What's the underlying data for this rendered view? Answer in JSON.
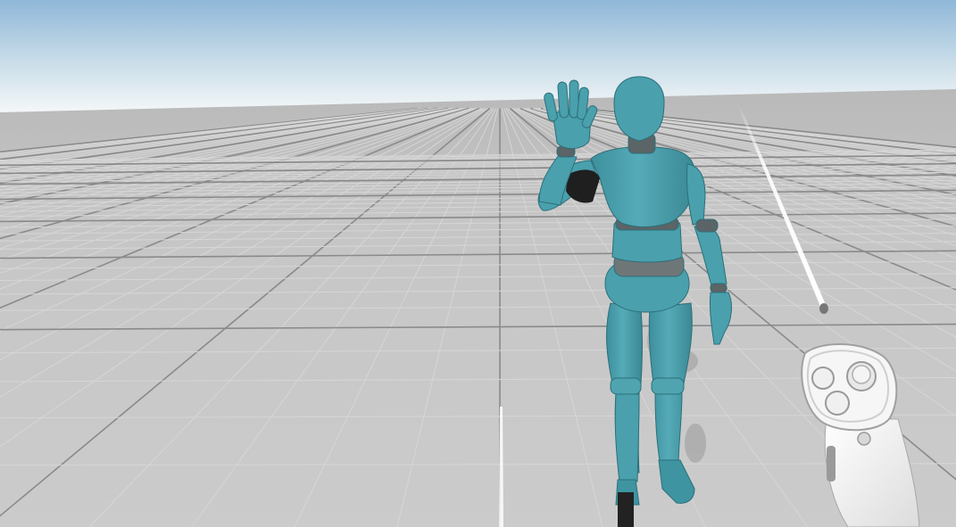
{
  "scene": {
    "type": "vr-3d-viewport",
    "environment": "infinite-grid-floor",
    "sky_top": "#9cc0dd",
    "sky_horizon": "#f2f6f8",
    "floor_color": "#c4c4c4",
    "grid_minor_color": "#d6d6d6",
    "grid_major_color": "#8a8a8a"
  },
  "avatar": {
    "name": "humanoid-mannequin",
    "pose": "waving-right-hand",
    "body_color": "#4aa0ad",
    "joint_color": "#6f7678"
  },
  "controller": {
    "name": "vr-motion-controller-right",
    "body_color": "#f2f2f2",
    "buttons": [
      "thumbstick",
      "button-a",
      "button-b",
      "menu-button"
    ]
  },
  "pointer": {
    "name": "laser-pointer-ray",
    "color": "#ffffff"
  }
}
